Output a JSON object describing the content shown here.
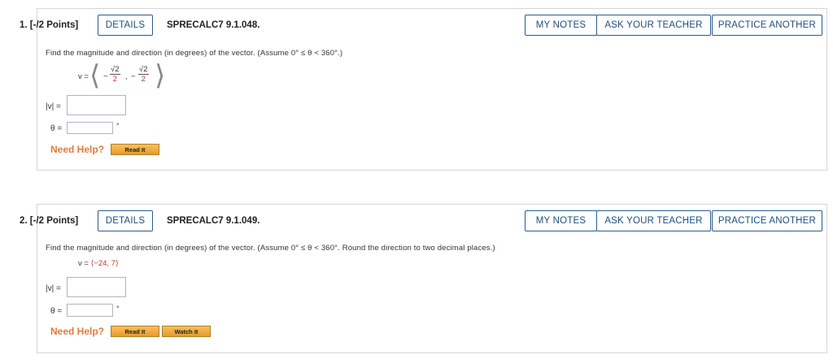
{
  "questions": [
    {
      "number": "1. [-/2 Points]",
      "details_label": "DETAILS",
      "code": "SPRECALC7 9.1.048.",
      "my_notes_label": "MY NOTES",
      "ask_teacher_label": "ASK YOUR TEACHER",
      "practice_label": "PRACTICE ANOTHER",
      "prompt": "Find the magnitude and direction (in degrees) of the vector. (Assume 0° ≤ θ < 360°.)",
      "vector_prefix": "v =",
      "comp1_sign": "−",
      "comp1_num": "√2",
      "comp1_den": "2",
      "comp_sep": ",",
      "comp2_sign": "−",
      "comp2_num": "√2",
      "comp2_den": "2",
      "magnitude_label": "|v| =",
      "theta_label": "θ =",
      "degree_symbol": "°",
      "need_help": "Need Help?",
      "help_buttons": [
        "Read It"
      ]
    },
    {
      "number": "2. [-/2 Points]",
      "details_label": "DETAILS",
      "code": "SPRECALC7 9.1.049.",
      "my_notes_label": "MY NOTES",
      "ask_teacher_label": "ASK YOUR TEACHER",
      "practice_label": "PRACTICE ANOTHER",
      "prompt": "Find the magnitude and direction (in degrees) of the vector. (Assume 0° ≤ θ < 360°. Round the direction to two decimal places.)",
      "vector_prefix": "v = ",
      "vector_value": "⟨−24, 7⟩",
      "magnitude_label": "|v| =",
      "theta_label": "θ =",
      "degree_symbol": "°",
      "need_help": "Need Help?",
      "help_buttons": [
        "Read It",
        "Watch It"
      ]
    }
  ],
  "colors": {
    "button_border": "#2a5d8f",
    "button_text": "#1f4e7a",
    "need_help": "#e07b39",
    "help_button": "#f0ad43",
    "vector_red": "#c0392b"
  }
}
